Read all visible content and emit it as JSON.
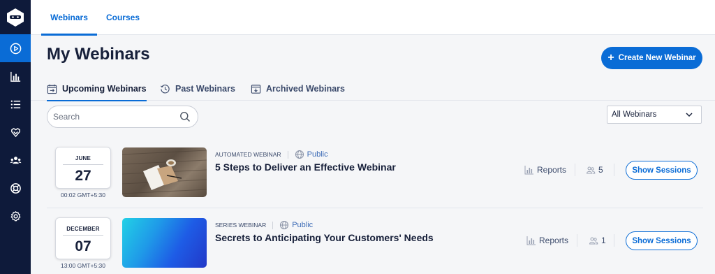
{
  "sidebar": {
    "items": [
      {
        "icon": "play-circle-icon"
      },
      {
        "icon": "bar-chart-icon"
      },
      {
        "icon": "list-icon"
      },
      {
        "icon": "integrations-icon"
      },
      {
        "icon": "team-icon"
      },
      {
        "icon": "help-lifebuoy-icon"
      },
      {
        "icon": "gear-icon"
      }
    ]
  },
  "topbar": {
    "tabs": [
      {
        "label": "Webinars",
        "active": true
      },
      {
        "label": "Courses",
        "active": false
      }
    ]
  },
  "header": {
    "title": "My Webinars",
    "create_label": "Create New Webinar"
  },
  "subtabs": [
    {
      "label": "Upcoming Webinars",
      "icon": "calendar-icon",
      "active": true
    },
    {
      "label": "Past Webinars",
      "icon": "history-icon",
      "active": false
    },
    {
      "label": "Archived Webinars",
      "icon": "archive-icon",
      "active": false
    }
  ],
  "search": {
    "placeholder": "Search",
    "value": ""
  },
  "filter": {
    "selected": "All Webinars"
  },
  "webinars": [
    {
      "month": "JUNE",
      "day": "27",
      "time": "00:02 GMT+5:30",
      "type": "AUTOMATED WEBINAR",
      "visibility": "Public",
      "title": "5 Steps to Deliver an Effective Webinar",
      "reports_label": "Reports",
      "attendees": "5",
      "button_label": "Show Sessions"
    },
    {
      "month": "DECEMBER",
      "day": "07",
      "time": "13:00 GMT+5:30",
      "type": "SERIES WEBINAR",
      "visibility": "Public",
      "title": "Secrets to Anticipating Your Customers' Needs",
      "reports_label": "Reports",
      "attendees": "1",
      "button_label": "Show Sessions"
    }
  ],
  "colors": {
    "sidebar": "#0e1a3a",
    "accent": "#0a6cd6",
    "text": "#17203a"
  }
}
